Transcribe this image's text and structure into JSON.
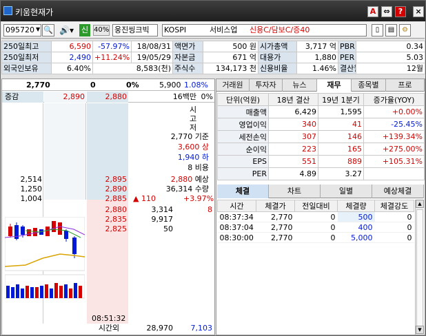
{
  "window": {
    "title": "키움현재가"
  },
  "titlebar_buttons": {
    "a_label": "A",
    "pin_label": "⇔",
    "help_label": "?",
    "close_label": "×"
  },
  "toolbar": {
    "code": "095720",
    "search_label": "🔍",
    "speaker_label": "🔊▾",
    "badge": "신",
    "pct": "40%",
    "name": "웅진씽크빅",
    "market": "KOSPI",
    "sector": "서비스업",
    "credit": "신용C/담보C/증40"
  },
  "summary": [
    {
      "l1": "250일최고",
      "v1": "6,590",
      "p1": "-57.97%",
      "d1": "18/08/31",
      "l2": "액면가",
      "v2": "500 원",
      "l3": "시가총액",
      "v3": "3,717 억",
      "l4": "PBR",
      "v4": "0.34"
    },
    {
      "l1": "250일최저",
      "v1": "2,490",
      "p1": "+11.24%",
      "d1": "19/05/29",
      "l2": "자본금",
      "v2": "671 억",
      "l3": "대용가",
      "v3": "1,880",
      "l4": "PER",
      "v4": "5.03"
    },
    {
      "l1": "외국인보유",
      "v1": "6.40%",
      "p1": "8,583(천)",
      "d1": "",
      "l2": "주식수",
      "v2": "134,173 천",
      "l3": "신용비율",
      "v3": "1.46%",
      "l4": "결산월",
      "v4": "12월"
    }
  ],
  "left": {
    "current_price": "2,770",
    "change": "0",
    "change_pct": "0%",
    "volume": "5,900",
    "vol_ratio": "1.08%",
    "col_hdr1": "증감",
    "col_hdr2": "2,890",
    "col_hdr3": "2,880",
    "col_hdr4": "16백만",
    "col_hdr5": "0%",
    "vert_label": [
      "시",
      "고",
      "저"
    ],
    "info_rows": [
      {
        "v": "2,770",
        "l": "기준"
      },
      {
        "v": "3,600",
        "l": "상"
      },
      {
        "v": "1,940",
        "l": "하"
      },
      {
        "v": "8",
        "l": "비용"
      }
    ],
    "bid_rows": [
      {
        "a": "2,514",
        "b": "2,895"
      },
      {
        "a": "1,250",
        "b": "2,890"
      },
      {
        "a": "1,004",
        "b": "2,885"
      }
    ],
    "mid_rows": [
      {
        "p": "2,880",
        "v": "예상"
      },
      {
        "p": "36,314",
        "v": "수량"
      },
      {
        "p": "▲ 110",
        "v": "+3.97%"
      }
    ],
    "ask_rows": [
      {
        "p": "2,880",
        "q": "3,314",
        "r": "8"
      },
      {
        "p": "2,835",
        "q": "9,917"
      },
      {
        "p": "2,825",
        "q": "50"
      }
    ],
    "time": "08:51:32",
    "after_label": "시간외",
    "after_v1": "28,970",
    "after_v2": "7,103"
  },
  "tabs": [
    "거래원",
    "투자자",
    "뉴스",
    "재무",
    "종목별",
    "프로"
  ],
  "active_tab": "재무",
  "fin": {
    "headers": [
      "단위(억원)",
      "18년 결산",
      "19년 1분기",
      "증가율(YOY)"
    ],
    "rows": [
      {
        "label": "매출액",
        "a": "6,429",
        "b": "1,595",
        "c": "+0.00%"
      },
      {
        "label": "영업이익",
        "a": "340",
        "b": "41",
        "c": "-25.45%"
      },
      {
        "label": "세전손익",
        "a": "307",
        "b": "146",
        "c": "+139.34%"
      },
      {
        "label": "순이익",
        "a": "223",
        "b": "165",
        "c": "+275.00%"
      },
      {
        "label": "EPS",
        "a": "551",
        "b": "889",
        "c": "+105.31%"
      },
      {
        "label": "PER",
        "a": "4.89",
        "b": "3.27",
        "c": ""
      }
    ]
  },
  "subtabs": [
    "체결",
    "차트",
    "일별",
    "예상체결"
  ],
  "trade": {
    "headers": [
      "시간",
      "체결가",
      "전일대비",
      "체결량",
      "체결강도"
    ],
    "rows": [
      {
        "time": "08:37:34",
        "price": "2,770",
        "diff": "0",
        "qty": "500",
        "str": "0"
      },
      {
        "time": "08:37:04",
        "price": "2,770",
        "diff": "0",
        "qty": "400",
        "str": "0"
      },
      {
        "time": "08:30:00",
        "price": "2,770",
        "diff": "0",
        "qty": "5,000",
        "str": "0"
      }
    ]
  }
}
